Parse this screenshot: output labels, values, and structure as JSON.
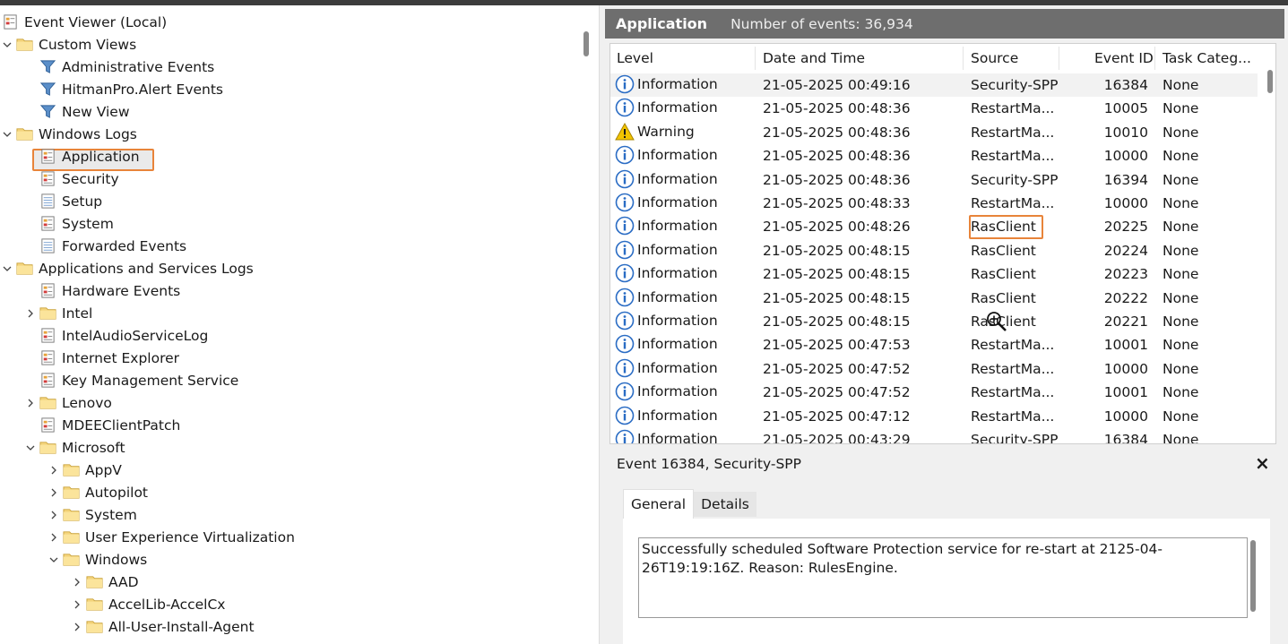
{
  "tree": {
    "items": [
      {
        "label": "Event Viewer (Local)",
        "icon": "event-viewer-icon",
        "chevron": ""
      },
      {
        "label": "Custom Views",
        "icon": "folder-icon",
        "chevron": "down"
      },
      {
        "label": "Administrative Events",
        "icon": "filter-icon",
        "chevron": ""
      },
      {
        "label": "HitmanPro.Alert Events",
        "icon": "filter-icon",
        "chevron": ""
      },
      {
        "label": "New View",
        "icon": "filter-icon",
        "chevron": ""
      },
      {
        "label": "Windows Logs",
        "icon": "folder-icon",
        "chevron": "down"
      },
      {
        "label": "Application",
        "icon": "log-icon",
        "chevron": ""
      },
      {
        "label": "Security",
        "icon": "log-icon",
        "chevron": ""
      },
      {
        "label": "Setup",
        "icon": "log-plain-icon",
        "chevron": ""
      },
      {
        "label": "System",
        "icon": "log-icon",
        "chevron": ""
      },
      {
        "label": "Forwarded Events",
        "icon": "log-plain-icon",
        "chevron": ""
      },
      {
        "label": "Applications and Services Logs",
        "icon": "folder-icon",
        "chevron": "down"
      },
      {
        "label": "Hardware Events",
        "icon": "log-icon",
        "chevron": ""
      },
      {
        "label": "Intel",
        "icon": "folder-icon",
        "chevron": "right"
      },
      {
        "label": "IntelAudioServiceLog",
        "icon": "log-icon",
        "chevron": ""
      },
      {
        "label": "Internet Explorer",
        "icon": "log-icon",
        "chevron": ""
      },
      {
        "label": "Key Management Service",
        "icon": "log-icon",
        "chevron": ""
      },
      {
        "label": "Lenovo",
        "icon": "folder-icon",
        "chevron": "right"
      },
      {
        "label": "MDEEClientPatch",
        "icon": "log-icon",
        "chevron": ""
      },
      {
        "label": "Microsoft",
        "icon": "folder-icon",
        "chevron": "down"
      },
      {
        "label": "AppV",
        "icon": "folder-icon",
        "chevron": "right"
      },
      {
        "label": "Autopilot",
        "icon": "folder-icon",
        "chevron": "right"
      },
      {
        "label": "System",
        "icon": "folder-icon",
        "chevron": "right"
      },
      {
        "label": "User Experience Virtualization",
        "icon": "folder-icon",
        "chevron": "right"
      },
      {
        "label": "Windows",
        "icon": "folder-icon",
        "chevron": "down"
      },
      {
        "label": "AAD",
        "icon": "folder-icon",
        "chevron": "right"
      },
      {
        "label": "AccelLib-AccelCx",
        "icon": "folder-icon",
        "chevron": "right"
      },
      {
        "label": "All-User-Install-Agent",
        "icon": "folder-icon",
        "chevron": "right"
      }
    ],
    "selected": "Application"
  },
  "header": {
    "title": "Application",
    "count": "Number of events: 36,934"
  },
  "grid": {
    "columns": [
      "Level",
      "Date and Time",
      "Source",
      "Event ID",
      "Task Categ..."
    ],
    "rows": [
      {
        "level": "Information",
        "datetime": "21-05-2025 00:49:16",
        "source": "Security-SPP",
        "event_id": "16384",
        "task": "None"
      },
      {
        "level": "Information",
        "datetime": "21-05-2025 00:48:36",
        "source": "RestartMa...",
        "event_id": "10005",
        "task": "None"
      },
      {
        "level": "Warning",
        "datetime": "21-05-2025 00:48:36",
        "source": "RestartMa...",
        "event_id": "10010",
        "task": "None"
      },
      {
        "level": "Information",
        "datetime": "21-05-2025 00:48:36",
        "source": "RestartMa...",
        "event_id": "10000",
        "task": "None"
      },
      {
        "level": "Information",
        "datetime": "21-05-2025 00:48:36",
        "source": "Security-SPP",
        "event_id": "16394",
        "task": "None"
      },
      {
        "level": "Information",
        "datetime": "21-05-2025 00:48:33",
        "source": "RestartMa...",
        "event_id": "10000",
        "task": "None"
      },
      {
        "level": "Information",
        "datetime": "21-05-2025 00:48:26",
        "source": "RasClient",
        "event_id": "20225",
        "task": "None"
      },
      {
        "level": "Information",
        "datetime": "21-05-2025 00:48:15",
        "source": "RasClient",
        "event_id": "20224",
        "task": "None"
      },
      {
        "level": "Information",
        "datetime": "21-05-2025 00:48:15",
        "source": "RasClient",
        "event_id": "20223",
        "task": "None"
      },
      {
        "level": "Information",
        "datetime": "21-05-2025 00:48:15",
        "source": "RasClient",
        "event_id": "20222",
        "task": "None"
      },
      {
        "level": "Information",
        "datetime": "21-05-2025 00:48:15",
        "source": "RasClient",
        "event_id": "20221",
        "task": "None"
      },
      {
        "level": "Information",
        "datetime": "21-05-2025 00:47:53",
        "source": "RestartMa...",
        "event_id": "10001",
        "task": "None"
      },
      {
        "level": "Information",
        "datetime": "21-05-2025 00:47:52",
        "source": "RestartMa...",
        "event_id": "10000",
        "task": "None"
      },
      {
        "level": "Information",
        "datetime": "21-05-2025 00:47:52",
        "source": "RestartMa...",
        "event_id": "10001",
        "task": "None"
      },
      {
        "level": "Information",
        "datetime": "21-05-2025 00:47:12",
        "source": "RestartMa...",
        "event_id": "10000",
        "task": "None"
      },
      {
        "level": "Information",
        "datetime": "21-05-2025 00:43:29",
        "source": "Security-SPP",
        "event_id": "16384",
        "task": "None"
      }
    ]
  },
  "details": {
    "title": "Event 16384, Security-SPP",
    "close": "×",
    "tabs": [
      "General",
      "Details"
    ],
    "message": "Successfully scheduled Software Protection service for re-start at 2125-04-26T19:19:16Z. Reason: RulesEngine."
  },
  "colors": {
    "highlight": "#e8843a",
    "header_bg": "#6e6e6e",
    "info_blue": "#2a6cc4",
    "warning_yellow": "#f2c400"
  }
}
